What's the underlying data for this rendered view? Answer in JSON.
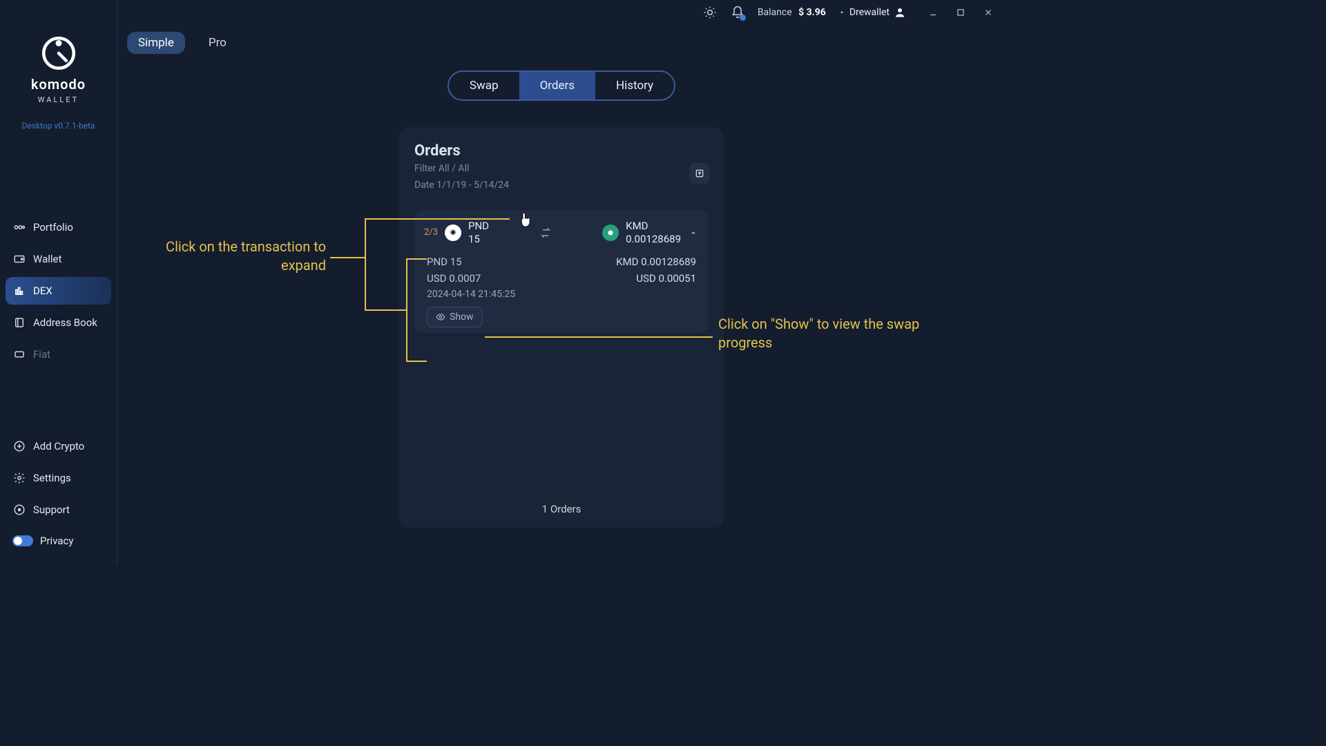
{
  "topbar": {
    "balance_label": "Balance",
    "balance_value": "$ 3.96",
    "user_name": "Drewallet"
  },
  "app": {
    "logo_text": "komodo",
    "logo_sub": "WALLET",
    "version": "Desktop v0.7.1-beta"
  },
  "sidebar": {
    "items": [
      {
        "label": "Portfolio",
        "icon": "portfolio-icon"
      },
      {
        "label": "Wallet",
        "icon": "wallet-icon"
      },
      {
        "label": "DEX",
        "icon": "dex-icon",
        "active": true
      },
      {
        "label": "Address Book",
        "icon": "addressbook-icon"
      },
      {
        "label": "Fiat",
        "icon": "fiat-icon",
        "disabled": true
      }
    ],
    "bottom": [
      {
        "label": "Add Crypto",
        "icon": "add-icon"
      },
      {
        "label": "Settings",
        "icon": "gear-icon"
      },
      {
        "label": "Support",
        "icon": "support-icon"
      },
      {
        "label": "Privacy",
        "icon": "toggle-icon",
        "toggle": true
      }
    ]
  },
  "tabs_top": {
    "simple": "Simple",
    "pro": "Pro"
  },
  "segmented": {
    "swap": "Swap",
    "orders": "Orders",
    "history": "History"
  },
  "panel": {
    "title": "Orders",
    "filter_line": "Filter All / All",
    "date_line": "Date 1/1/19 - 5/14/24",
    "footer": "1 Orders"
  },
  "order": {
    "fraction": "2/3",
    "from_sym": "PND",
    "from_amt": "15",
    "to_sym": "KMD",
    "to_amt": "0.00128689",
    "detail_from": "PND 15",
    "detail_to": "KMD 0.00128689",
    "detail_from_usd": "USD 0.0007",
    "detail_to_usd": "USD 0.00051",
    "timestamp": "2024-04-14 21:45:25",
    "show_label": "Show"
  },
  "annotations": {
    "left": "Click on the transaction to expand",
    "right": "Click on \"Show\" to view the swap progress"
  }
}
